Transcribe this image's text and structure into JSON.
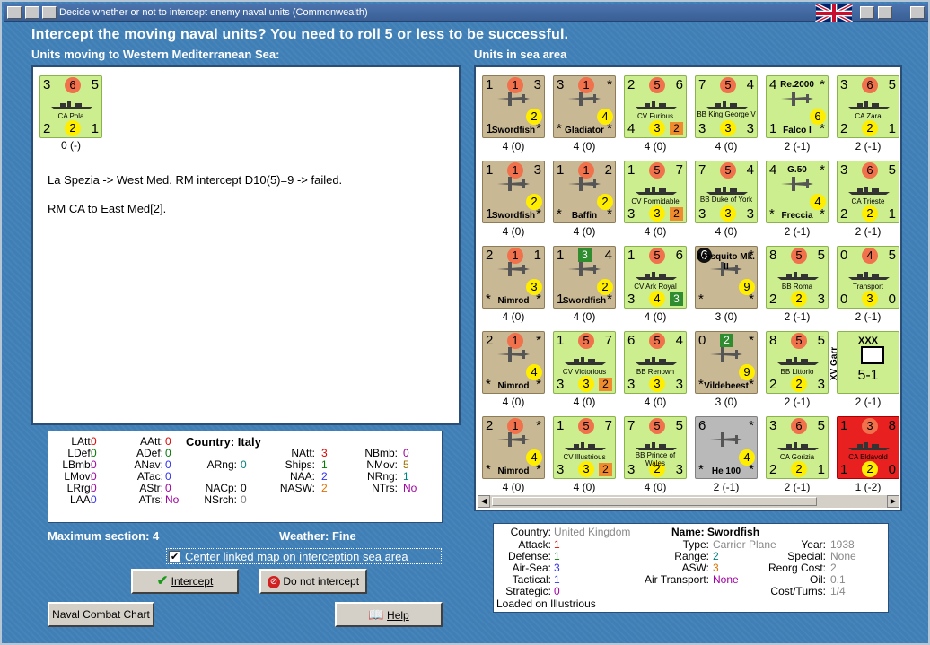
{
  "window": {
    "title": "Decide whether or not to intercept enemy naval units (Commonwealth)"
  },
  "heading": "Intercept the moving naval units?  You need to roll 5 or less to be successful.",
  "left_label": "Units moving to Western Mediterranean Sea:",
  "right_label": "Units in sea area",
  "moving_unit": {
    "tl": "3",
    "tr": "5",
    "bl": "2",
    "br": "1",
    "att": "6",
    "mid": "2",
    "name": "CA Pola",
    "caption": "0 (-)"
  },
  "log": [
    "La Spezia -> West Med.  RM intercept D10(5)=9 -> failed.",
    "RM CA to East Med[2]."
  ],
  "units": [
    {
      "name": "Swordfish",
      "tl": "1",
      "tr": "3",
      "bl": "1",
      "br": "*",
      "a": "1",
      "y": "2",
      "cap": "4 (0)",
      "k": "plane"
    },
    {
      "name": "Gladiator",
      "tl": "3",
      "tr": "*",
      "bl": "*",
      "br": "*",
      "a": "1",
      "y": "4",
      "cap": "4 (0)",
      "k": "plane"
    },
    {
      "name": "CV Furious",
      "tl": "2",
      "tr": "6",
      "bl": "4",
      "br": "",
      "a": "5",
      "y": "3",
      "o": "2",
      "cap": "4 (0)",
      "k": "ship"
    },
    {
      "name": "BB King George V",
      "tl": "7",
      "tr": "4",
      "bl": "3",
      "br": "3",
      "a": "5",
      "y": "3",
      "cap": "4 (0)",
      "k": "ship"
    },
    {
      "name": "Falco I",
      "tl": "4",
      "tr": "*",
      "bl": "1",
      "br": "*",
      "top": "Re.2000",
      "y": "6",
      "cap": "2 (-1)",
      "k": "plane"
    },
    {
      "name": "CA Zara",
      "tl": "3",
      "tr": "5",
      "bl": "2",
      "br": "1",
      "a": "6",
      "y": "2",
      "cap": "2 (-1)",
      "k": "ship"
    },
    {
      "name": "Swordfish",
      "tl": "1",
      "tr": "3",
      "bl": "1",
      "br": "*",
      "a": "1",
      "y": "2",
      "cap": "4 (0)",
      "k": "plane"
    },
    {
      "name": "Baffin",
      "tl": "1",
      "tr": "2",
      "bl": "*",
      "br": "*",
      "a": "1",
      "y": "2",
      "cap": "4 (0)",
      "k": "plane"
    },
    {
      "name": "CV Formidable",
      "tl": "1",
      "tr": "7",
      "bl": "3",
      "br": "",
      "a": "5",
      "y": "3",
      "o": "2",
      "cap": "4 (0)",
      "k": "ship"
    },
    {
      "name": "BB Duke of York",
      "tl": "7",
      "tr": "4",
      "bl": "3",
      "br": "3",
      "a": "5",
      "y": "3",
      "cap": "4 (0)",
      "k": "ship"
    },
    {
      "name": "Freccia",
      "tl": "4",
      "tr": "*",
      "bl": "*",
      "br": "*",
      "top": "G.50",
      "y": "4",
      "cap": "2 (-1)",
      "k": "plane"
    },
    {
      "name": "CA Trieste",
      "tl": "3",
      "tr": "5",
      "bl": "2",
      "br": "1",
      "a": "6",
      "y": "2",
      "cap": "2 (-1)",
      "k": "ship"
    },
    {
      "name": "Nimrod",
      "tl": "2",
      "tr": "1",
      "bl": "*",
      "br": "*",
      "a": "1",
      "y": "3",
      "cap": "4 (0)",
      "k": "plane"
    },
    {
      "name": "Swordfish",
      "tl": "1",
      "tr": "4",
      "bl": "1",
      "br": "*",
      "g": "3",
      "y": "2",
      "cap": "4 (0)",
      "k": "plane"
    },
    {
      "name": "CV Ark Royal",
      "tl": "1",
      "tr": "6",
      "bl": "3",
      "br": "",
      "a": "5",
      "y": "4",
      "gs": "3",
      "cap": "4 (0)",
      "k": "ship"
    },
    {
      "name": "Mosquito Mk. II",
      "tl": "6",
      "tr": "*",
      "bl": "*",
      "br": "*",
      "y": "9",
      "cap": "3 (0)",
      "k": "plane",
      "black": true
    },
    {
      "name": "BB Roma",
      "tl": "8",
      "tr": "5",
      "bl": "2",
      "br": "3",
      "a": "5",
      "y": "2",
      "cap": "2 (-1)",
      "k": "ship"
    },
    {
      "name": "Transport",
      "tl": "0",
      "tr": "5",
      "bl": "0",
      "br": "0",
      "a": "4",
      "y": "3",
      "cap": "2 (-1)",
      "k": "ship"
    },
    {
      "name": "Nimrod",
      "tl": "2",
      "tr": "*",
      "bl": "*",
      "br": "*",
      "a": "1",
      "y": "4",
      "cap": "4 (0)",
      "k": "plane"
    },
    {
      "name": "CV Victorious",
      "tl": "1",
      "tr": "7",
      "bl": "3",
      "br": "",
      "a": "5",
      "y": "3",
      "o": "2",
      "cap": "4 (0)",
      "k": "ship"
    },
    {
      "name": "BB Renown",
      "tl": "6",
      "tr": "4",
      "bl": "3",
      "br": "3",
      "a": "5",
      "y": "3",
      "cap": "4 (0)",
      "k": "ship"
    },
    {
      "name": "Vildebeest",
      "tl": "0",
      "tr": "*",
      "bl": "*",
      "br": "*",
      "g": "2",
      "y": "9",
      "cap": "3 (0)",
      "k": "plane"
    },
    {
      "name": "BB Littorio",
      "tl": "8",
      "tr": "5",
      "bl": "2",
      "br": "3",
      "a": "5",
      "y": "2",
      "cap": "2 (-1)",
      "k": "ship"
    },
    {
      "name": "XV Garr",
      "tl": "",
      "tr": "",
      "bl": "",
      "br": "",
      "cap": "2 (-1)",
      "k": "garr",
      "top": "XXX",
      "str": "5-1"
    },
    {
      "name": "Nimrod",
      "tl": "2",
      "tr": "*",
      "bl": "*",
      "br": "*",
      "a": "1",
      "y": "4",
      "cap": "4 (0)",
      "k": "plane"
    },
    {
      "name": "CV Illustrious",
      "tl": "1",
      "tr": "7",
      "bl": "3",
      "br": "",
      "a": "5",
      "y": "3",
      "o": "2",
      "cap": "4 (0)",
      "k": "ship"
    },
    {
      "name": "BB Prince of Wales",
      "tl": "7",
      "tr": "5",
      "bl": "3",
      "br": "3",
      "a": "5",
      "y": "2",
      "cap": "4 (0)",
      "k": "ship"
    },
    {
      "name": "He 100",
      "tl": "6",
      "tr": "*",
      "bl": "*",
      "br": "*",
      "y": "4",
      "cap": "2 (-1)",
      "k": "plane",
      "grey": true
    },
    {
      "name": "CA Gorizia",
      "tl": "3",
      "tr": "5",
      "bl": "2",
      "br": "1",
      "a": "6",
      "y": "2",
      "cap": "2 (-1)",
      "k": "ship"
    },
    {
      "name": "CA Eldavold",
      "tl": "1",
      "tr": "8",
      "bl": "1",
      "br": "0",
      "a": "3",
      "y": "2",
      "cap": "1 (-2)",
      "k": "ship",
      "red": true
    }
  ],
  "stats": {
    "LAtt": "0",
    "LDef": "0",
    "LBmb": "0",
    "LMov": "0",
    "LRrg": "0",
    "LAA": "0",
    "AAtt": "0",
    "ADef": "0",
    "ANav": "0",
    "ATac": "0",
    "AStr": "0",
    "ATrs": "No",
    "Country": "Italy",
    "ARng": "0",
    "NACp": "0",
    "NSrch": "0",
    "NAtt": "3",
    "Ships": "1",
    "NAA": "2",
    "NASW": "2",
    "NBmb": "0",
    "NMov": "5",
    "NRng": "1",
    "NTrs": "No"
  },
  "max_section": "Maximum section: 4",
  "weather": "Weather:  Fine",
  "center_link": "Center linked map on interception sea area",
  "buttons": {
    "intercept": "Intercept",
    "no_intercept": "Do not intercept",
    "naval_chart": "Naval Combat Chart",
    "help": "Help"
  },
  "info": {
    "country": "United Kingdom",
    "name": "Swordfish",
    "attack": "1",
    "defense": "1",
    "air_sea": "3",
    "tactical": "1",
    "strategic": "0",
    "type": "Carrier Plane",
    "range": "2",
    "asw": "3",
    "air_transport": "None",
    "year": "1938",
    "special": "None",
    "reorg_cost": "2",
    "oil": "0.1",
    "cost_turns": "1/4",
    "loaded": "Loaded on Illustrious"
  },
  "colors": {
    "blue": "#2e30f0",
    "green": "#007a00",
    "red": "#e00000",
    "orange": "#e07000",
    "purple": "#a000a0",
    "teal": "#008080"
  }
}
